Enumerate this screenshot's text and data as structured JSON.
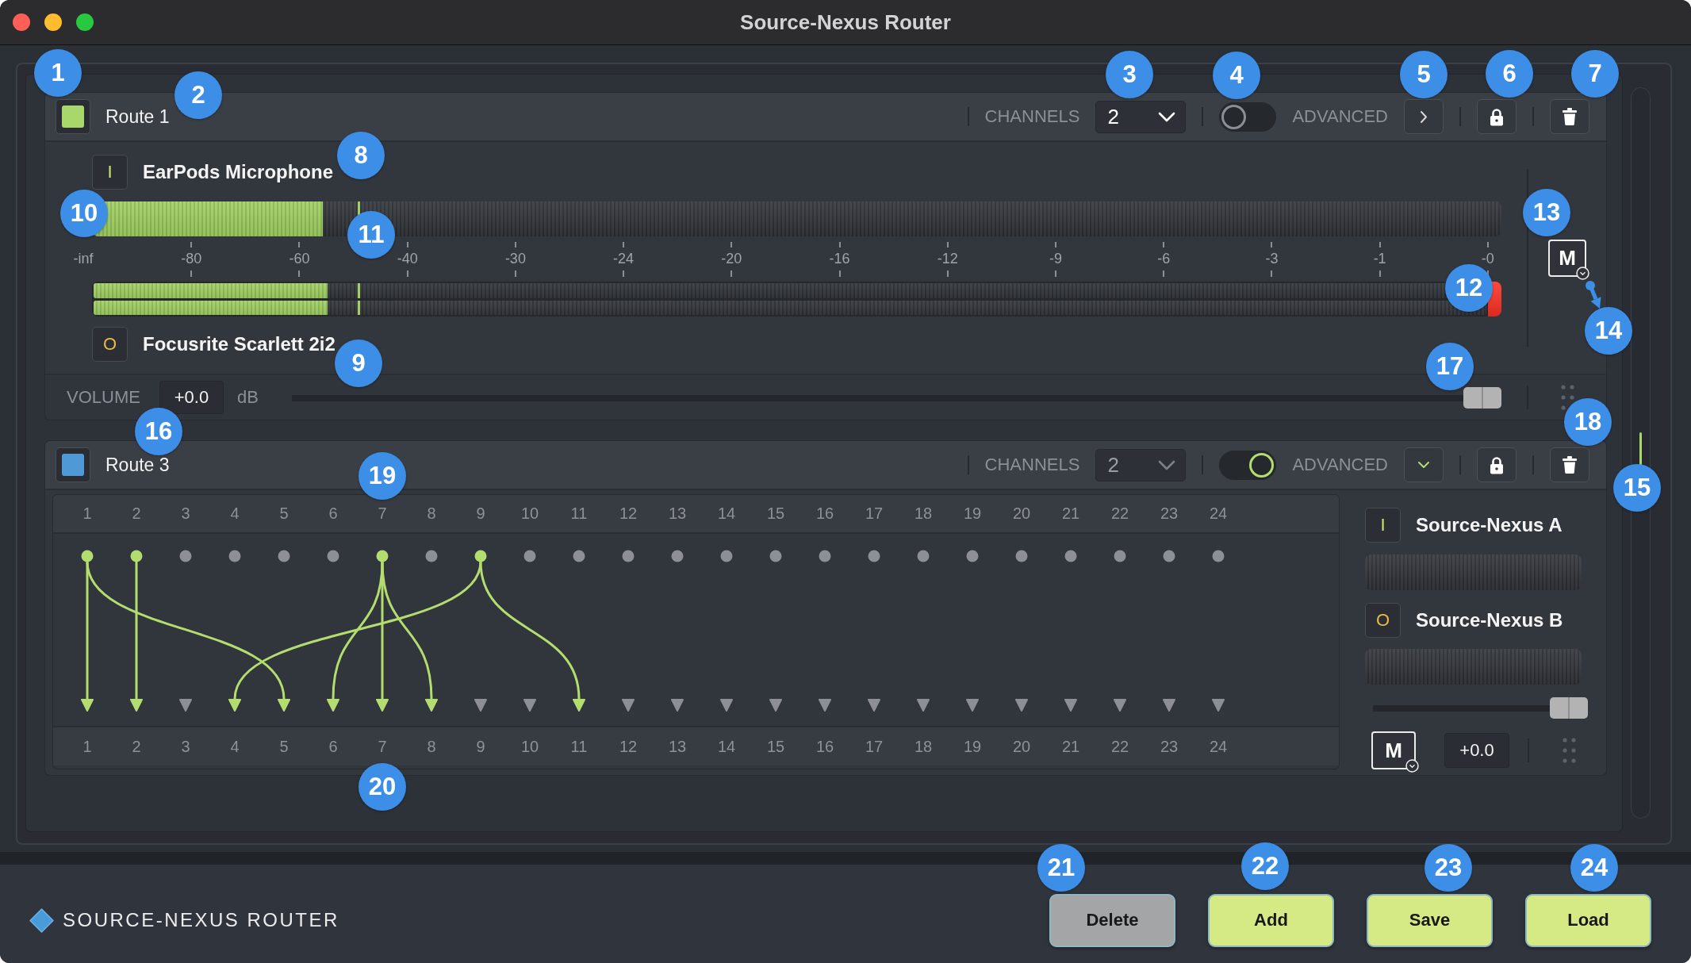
{
  "window": {
    "title": "Source-Nexus Router"
  },
  "routes": [
    {
      "kind": "meters",
      "name": "Route 1",
      "color": "#a8d86c",
      "channels": {
        "label": "CHANNELS",
        "value": "2",
        "disabled": false
      },
      "advanced": {
        "label": "ADVANCED",
        "on": false,
        "expanded": false
      },
      "input": {
        "badge": "I",
        "name": "EarPods Microphone",
        "meter": {
          "level": 0.164,
          "peak": {
            "level": 0.189
          }
        }
      },
      "scale": [
        "-inf",
        "-80",
        "-60",
        "-40",
        "-30",
        "-24",
        "-20",
        "-16",
        "-12",
        "-9",
        "-6",
        "-3",
        "-1",
        "-0"
      ],
      "output": {
        "badge": "O",
        "name": "Focusrite Scarlett 2i2",
        "meters": [
          {
            "level": 0.168,
            "peak": {
              "level": 0.19
            }
          },
          {
            "level": 0.168,
            "peak": {
              "level": 0.19
            }
          }
        ],
        "clip": true
      },
      "mute": {
        "label": "M"
      },
      "volume": {
        "label": "VOLUME",
        "value": "+0.0",
        "unit": "dB",
        "level": 1
      }
    },
    {
      "kind": "matrix",
      "name": "Route 3",
      "color": "#4f9ad6",
      "channels": {
        "label": "CHANNELS",
        "value": "2",
        "disabled": true
      },
      "advanced": {
        "label": "ADVANCED",
        "on": true,
        "expanded": true
      },
      "matrix": {
        "inputs": [
          {
            "label": "1",
            "active": true,
            "targets": [
              true,
              false,
              false,
              false,
              true
            ]
          },
          {
            "label": "2",
            "active": true,
            "targets": [
              false,
              true
            ]
          },
          {
            "label": "3",
            "active": false
          },
          {
            "label": "4",
            "active": false
          },
          {
            "label": "5",
            "active": false
          },
          {
            "label": "6",
            "active": false
          },
          {
            "label": "7",
            "active": true,
            "targets": [
              false,
              false,
              false,
              false,
              false,
              true,
              true,
              true
            ]
          },
          {
            "label": "8",
            "active": false
          },
          {
            "label": "9",
            "active": true,
            "targets": [
              false,
              false,
              false,
              true,
              false,
              false,
              false,
              false,
              false,
              false,
              true
            ]
          },
          {
            "label": "10",
            "active": false
          },
          {
            "label": "11",
            "active": false
          },
          {
            "label": "12",
            "active": false
          },
          {
            "label": "13",
            "active": false
          },
          {
            "label": "14",
            "active": false
          },
          {
            "label": "15",
            "active": false
          },
          {
            "label": "16",
            "active": false
          },
          {
            "label": "17",
            "active": false
          },
          {
            "label": "18",
            "active": false
          },
          {
            "label": "19",
            "active": false
          },
          {
            "label": "20",
            "active": false
          },
          {
            "label": "21",
            "active": false
          },
          {
            "label": "22",
            "active": false
          },
          {
            "label": "23",
            "active": false
          },
          {
            "label": "24",
            "active": false
          }
        ],
        "outputs": [
          {
            "label": "1",
            "active": true
          },
          {
            "label": "2",
            "active": true
          },
          {
            "label": "3",
            "active": false
          },
          {
            "label": "4",
            "active": true
          },
          {
            "label": "5",
            "active": true
          },
          {
            "label": "6",
            "active": true
          },
          {
            "label": "7",
            "active": true
          },
          {
            "label": "8",
            "active": true
          },
          {
            "label": "9",
            "active": false
          },
          {
            "label": "10",
            "active": false
          },
          {
            "label": "11",
            "active": true
          },
          {
            "label": "12",
            "active": false
          },
          {
            "label": "13",
            "active": false
          },
          {
            "label": "14",
            "active": false
          },
          {
            "label": "15",
            "active": false
          },
          {
            "label": "16",
            "active": false
          },
          {
            "label": "17",
            "active": false
          },
          {
            "label": "18",
            "active": false
          },
          {
            "label": "19",
            "active": false
          },
          {
            "label": "20",
            "active": false
          },
          {
            "label": "21",
            "active": false
          },
          {
            "label": "22",
            "active": false
          },
          {
            "label": "23",
            "active": false
          },
          {
            "label": "24",
            "active": false
          }
        ]
      },
      "input": {
        "badge": "I",
        "name": "Source-Nexus A"
      },
      "output": {
        "badge": "O",
        "name": "Source-Nexus B"
      },
      "volume": {
        "value": "+0.0",
        "level": 1
      },
      "mute": {
        "label": "M"
      }
    }
  ],
  "footer": {
    "brand": "SOURCE-NEXUS ROUTER",
    "buttons": [
      {
        "label": "Delete",
        "disabled": true
      },
      {
        "label": "Add",
        "disabled": false
      },
      {
        "label": "Save",
        "disabled": false
      },
      {
        "label": "Load",
        "disabled": false
      }
    ]
  },
  "callouts": [
    "1",
    "2",
    "3",
    "4",
    "5",
    "6",
    "7",
    "8",
    "9",
    "10",
    "11",
    "12",
    "13",
    "14",
    "15",
    "16",
    "17",
    "18",
    "19",
    "20",
    "21",
    "22",
    "23",
    "24"
  ]
}
